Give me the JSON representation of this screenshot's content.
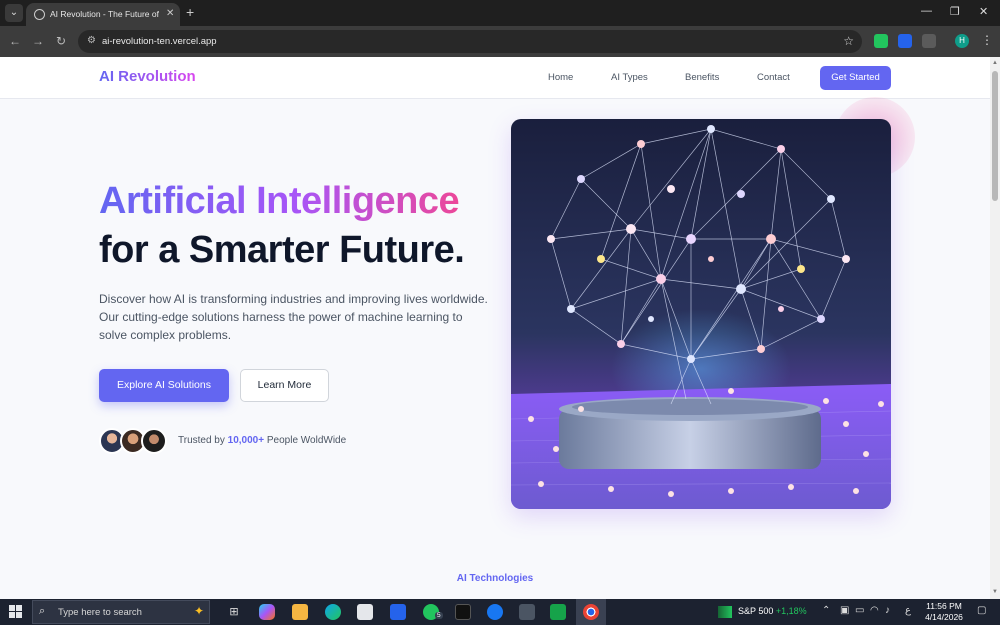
{
  "browser": {
    "tab_title": "AI Revolution - The Future of AI",
    "url": "ai-revolution-ten.vercel.app",
    "profile_initial": "H"
  },
  "site": {
    "logo": "AI Revolution",
    "nav": [
      "Home",
      "AI Types",
      "Benefits",
      "Contact"
    ],
    "cta": "Get Started"
  },
  "hero": {
    "title_line1": "Artificial Intelligence",
    "title_line2": "for a Smarter Future.",
    "description": "Discover how AI is transforming industries and improving lives worldwide. Our cutting-edge solutions harness the power of machine learning to solve complex problems.",
    "primary_button": "Explore AI Solutions",
    "secondary_button": "Learn More",
    "trusted_prefix": "Trusted by",
    "trusted_count": "10,000+",
    "trusted_suffix": "People WoldWide"
  },
  "next_section": {
    "eyebrow": "AI Technologies"
  },
  "taskbar": {
    "search_placeholder": "Type here to search",
    "stock_name": "S&P 500",
    "stock_change": "+1,18%",
    "time": "11:56 PM",
    "date": "4/14/2026",
    "whatsapp_badge": "5"
  },
  "colors": {
    "accent": "#6366f1",
    "gradient_end": "#ec4899",
    "heading": "#0f172a"
  }
}
